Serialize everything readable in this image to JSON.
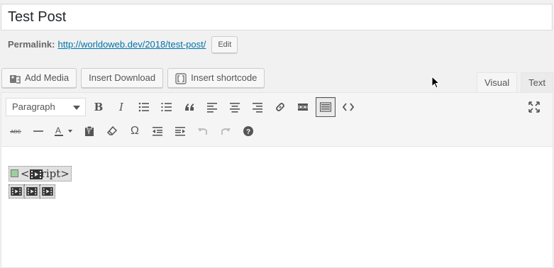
{
  "post": {
    "title": "Test Post",
    "permalink_label": "Permalink:",
    "permalink_url": "http://worldoweb.dev/2018/test-post/",
    "edit_label": "Edit"
  },
  "media_buttons": {
    "add_media": "Add Media",
    "insert_download": "Insert Download",
    "insert_shortcode": "Insert shortcode"
  },
  "editor_tabs": {
    "visual": "Visual",
    "text": "Text",
    "active": "Visual"
  },
  "toolbar": {
    "format_select": "Paragraph",
    "row1_icons": [
      "bold-icon",
      "italic-icon",
      "bullet-list-icon",
      "numbered-list-icon",
      "blockquote-icon",
      "align-left-icon",
      "align-center-icon",
      "align-right-icon",
      "link-icon",
      "read-more-icon",
      "toolbar-toggle-icon",
      "code-icon"
    ],
    "row2_icons": [
      "strikethrough-icon",
      "horizontal-line-icon",
      "text-color-icon",
      "paste-text-icon",
      "clear-formatting-icon",
      "special-character-icon",
      "outdent-icon",
      "indent-icon",
      "undo-icon",
      "redo-icon",
      "help-icon"
    ],
    "expand_icon": "fullscreen-icon"
  },
  "content": {
    "broken_image_alt": "<script>",
    "video_placeholders": 3
  },
  "colors": {
    "link": "#0073aa",
    "background": "#f1f1f1",
    "toolbar": "#f5f5f5"
  }
}
